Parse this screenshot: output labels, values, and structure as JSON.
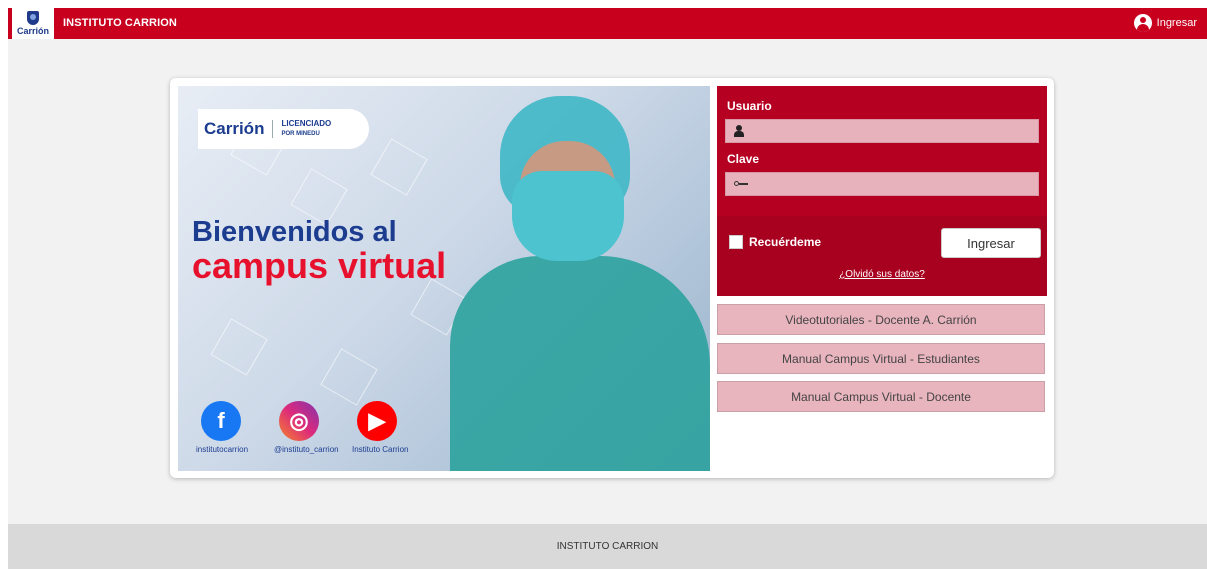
{
  "topbar": {
    "logo_text": "Carrión",
    "brand": "INSTITUTO CARRION",
    "login_label": "Ingresar",
    "accent": "#c8001e"
  },
  "banner": {
    "pill_brand": "Carrión",
    "pill_badge_line1": "LICENCIADO",
    "pill_badge_line2": "POR MINEDU",
    "headline_1": "Bienvenidos al",
    "headline_2": "campus virtual",
    "socials": [
      {
        "icon": "facebook-icon",
        "label": "institutocarrion",
        "color": "#1877f2"
      },
      {
        "icon": "instagram-icon",
        "label": "@instituto_carrion",
        "color": "#c13584"
      },
      {
        "icon": "youtube-icon",
        "label": "Instituto Carrion",
        "color": "#ff0000"
      }
    ]
  },
  "login": {
    "user_label": "Usuario",
    "user_value": "",
    "pass_label": "Clave",
    "pass_value": "",
    "remember_label": "Recuérdeme",
    "submit_label": "Ingresar",
    "forgot_label": "¿Olvidó sus datos?"
  },
  "links": [
    "Videotutoriales - Docente A. Carrión",
    "Manual Campus Virtual - Estudiantes",
    "Manual Campus Virtual - Docente"
  ],
  "footer": {
    "text": "INSTITUTO CARRION"
  }
}
